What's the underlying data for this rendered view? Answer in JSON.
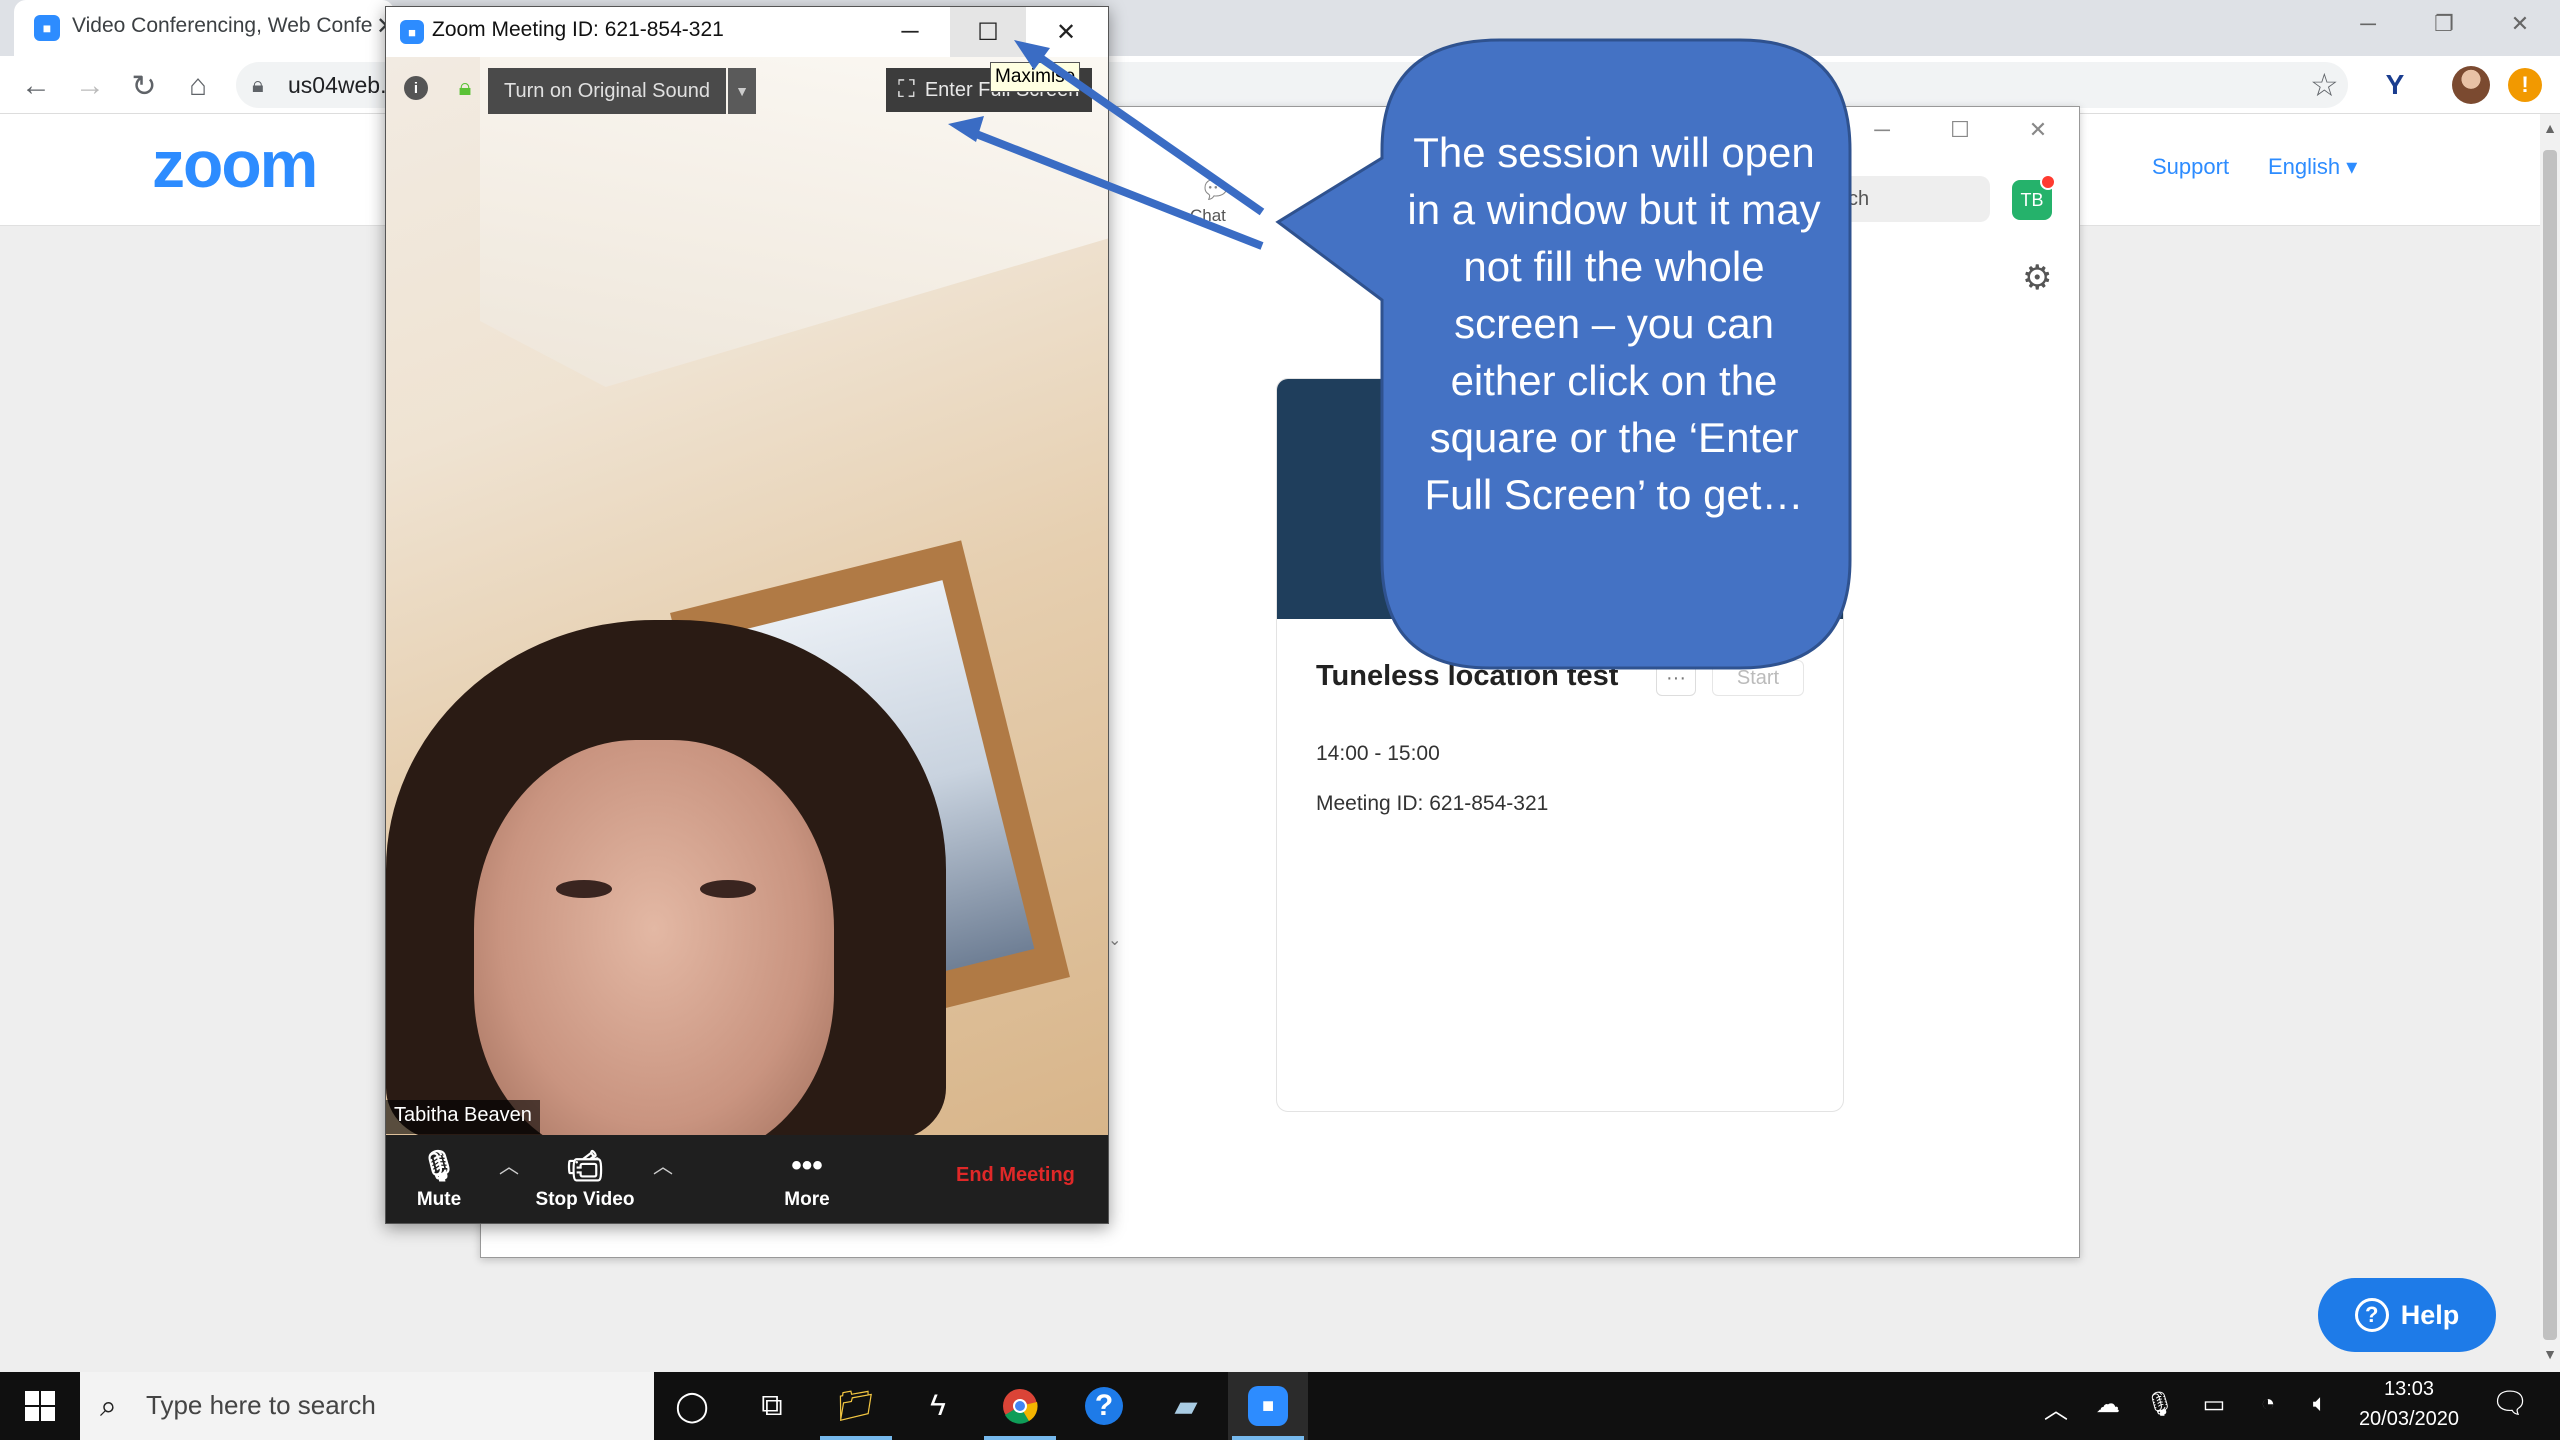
{
  "browser": {
    "tab_title": "Video Conferencing, Web Confe",
    "tab_close": "✕",
    "url": "us04web.",
    "minimize": "─",
    "restore": "❐",
    "close": "✕"
  },
  "web": {
    "logo": "zoom",
    "support": "Support",
    "language": "English ▾",
    "help": "Help"
  },
  "client": {
    "chat_label": "Chat",
    "search_text": "ch",
    "avatar": "TB",
    "meeting": {
      "title": "Tuneless location test",
      "more": "···",
      "start": "Start",
      "time": "14:00 - 15:00",
      "id": "Meeting ID: 621-854-321"
    }
  },
  "meeting_window": {
    "title": "Zoom Meeting ID: 621-854-321",
    "minimize": "─",
    "maximize": "☐",
    "close": "✕",
    "tooltip": "Maximise",
    "original_sound": "Turn on Original Sound",
    "full_screen": "Enter Full Screen",
    "participant_name": "Tabitha Beaven",
    "controls": {
      "mute": "Mute",
      "stop_video": "Stop Video",
      "more": "More",
      "end": "End Meeting"
    }
  },
  "callout": {
    "text": "The session will open in a window but it may not fill the whole screen – you can either click on the square or the ‘Enter Full Screen’ to get…",
    "fill": "#4472c4",
    "stroke": "#2f528f"
  },
  "taskbar": {
    "search_placeholder": "Type here to search",
    "time": "13:03",
    "date": "20/03/2020"
  }
}
